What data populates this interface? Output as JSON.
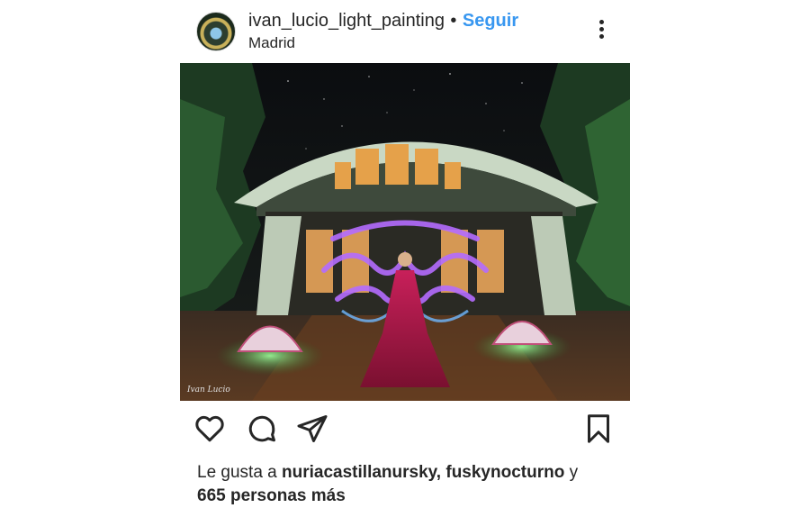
{
  "post": {
    "username": "ivan_lucio_light_painting",
    "separator": "•",
    "follow_label": "Seguir",
    "location": "Madrid"
  },
  "photo": {
    "signature": "Ivan Lucio"
  },
  "icons": {
    "avatar": "avatar-photo",
    "more": "more-vertical-icon",
    "like": "heart-icon",
    "comment": "comment-bubble-icon",
    "share": "paper-plane-icon",
    "save": "bookmark-icon"
  },
  "likes": {
    "prefix": "Le gusta a ",
    "users": "nuriacastillanursky, fuskynocturno",
    "middle": " y",
    "count_text": "665 personas más"
  },
  "colors": {
    "link_blue": "#3897f0",
    "text": "#262626"
  }
}
